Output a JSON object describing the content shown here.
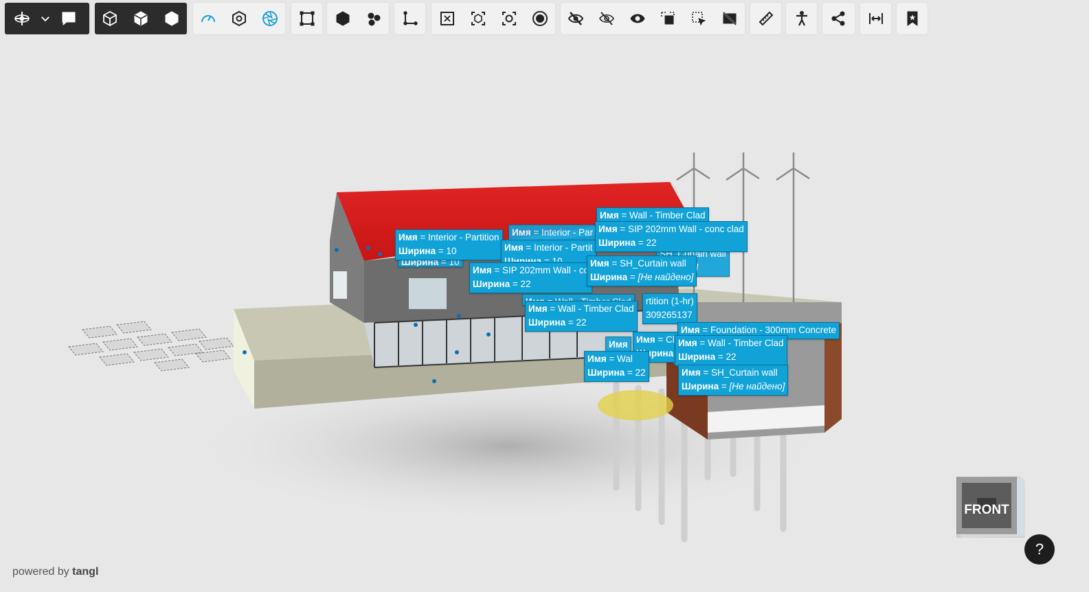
{
  "toolbar": {
    "groups": [
      {
        "name": "navigation",
        "items": [
          "orbit-icon",
          "chevron-down-icon",
          "comment-icon"
        ]
      },
      {
        "name": "view-mode",
        "items": [
          "cube-outline-icon",
          "cube-half-icon",
          "cube-solid-icon"
        ]
      },
      {
        "name": "tools",
        "items": [
          "speed-icon",
          "hexagon-icon",
          "aperture-icon"
        ]
      }
    ]
  },
  "labels": [
    {
      "name": "Интерьер",
      "lines": [
        [
          "Имя",
          "Interior - Partition"
        ],
        [
          "Ширина",
          "10"
        ]
      ]
    },
    {
      "name": "Стена1",
      "lines": [
        [
          "Имя",
          "Wall - Timber Clad"
        ]
      ]
    },
    {
      "name": "Стена2",
      "lines": [
        [
          "Имя",
          "SIP 202mm Wall - conc clad"
        ],
        [
          "Ширина",
          "22"
        ]
      ]
    },
    {
      "name": "Интерьер2",
      "lines": [
        [
          "Имя",
          "Interior - Partit"
        ]
      ]
    },
    {
      "name": "SIP2",
      "lines": [
        [
          "Имя",
          "SIP 202mm Wall - co"
        ],
        [
          "Ширина",
          "22"
        ]
      ]
    },
    {
      "name": "Curtain1",
      "lines": [
        [
          "Имя",
          "SH_Curtain wall"
        ],
        [
          "Ширина",
          "[Не найдено]"
        ]
      ]
    },
    {
      "name": "Partition1hr",
      "lines": [
        [
          "",
          "rtition (1-hr)"
        ],
        [
          "",
          "309265137"
        ]
      ]
    },
    {
      "name": "Wall3",
      "lines": [
        [
          "Имя",
          "Wall - Timber Clad"
        ],
        [
          "Ширина",
          "22"
        ]
      ]
    },
    {
      "name": "Foundation",
      "lines": [
        [
          "Имя",
          "Foundation - 300mm Concrete"
        ]
      ]
    },
    {
      "name": "Wall4",
      "lines": [
        [
          "Имя",
          "Wall - Timber Clad"
        ],
        [
          "Ширина",
          "22"
        ]
      ]
    },
    {
      "name": "Wall5",
      "lines": [
        [
          "Имя",
          "Wal"
        ],
        [
          "Ширина",
          "22"
        ]
      ]
    },
    {
      "name": "Curtain2",
      "lines": [
        [
          "Имя",
          "SH_Curtain wall"
        ],
        [
          "Ширина",
          "[Не найдено]"
        ]
      ]
    },
    {
      "name": "Partial1",
      "lines": [
        [
          "Имя",
          "Cl"
        ],
        [
          "Ширина",
          ""
        ]
      ]
    }
  ],
  "cube_label": "FRONT",
  "brand_prefix": "powered by",
  "brand_name": "tangl",
  "help_label": "?"
}
